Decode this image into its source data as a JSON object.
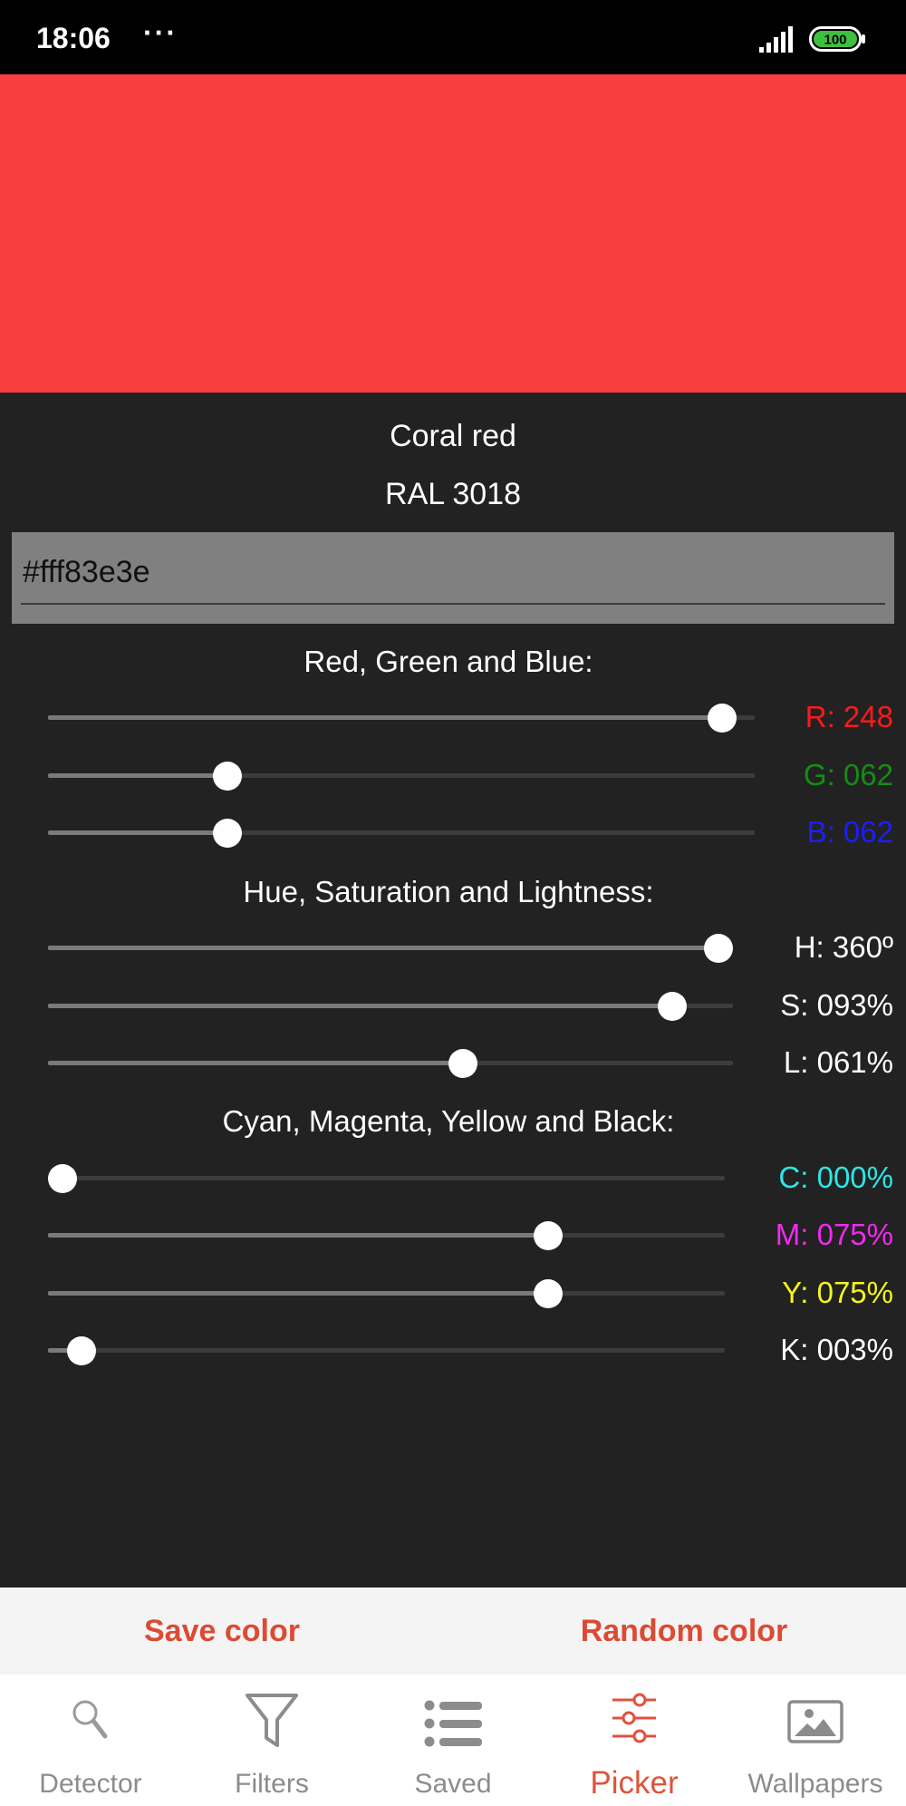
{
  "status": {
    "time": "18:06",
    "dots": "···",
    "battery": "100"
  },
  "colors": {
    "preview": "#f83e3e",
    "accent": "#db4b34",
    "red_label": "#ff1a1a",
    "green_label": "#168c16",
    "blue_label": "#1d1dff",
    "cyan_label": "#2ee6e6",
    "magenta_label": "#f02af0",
    "yellow_label": "#f5f51e",
    "white_label": "#ffffff"
  },
  "color": {
    "name": "Coral red",
    "ral": "RAL 3018",
    "hex": "#fff83e3e"
  },
  "rgb": {
    "title": "Red, Green and Blue:",
    "r": {
      "label": "R: 248",
      "level": 0.973
    },
    "g": {
      "label": "G: 062",
      "level": 0.243
    },
    "b": {
      "label": "B: 062",
      "level": 0.243
    }
  },
  "hsl": {
    "title": "Hue, Saturation and Lightness:",
    "h": {
      "label": "H: 360º",
      "level": 1.0
    },
    "s": {
      "label": "S: 093%",
      "level": 0.93
    },
    "l": {
      "label": "L: 061%",
      "level": 0.61
    }
  },
  "cmyk": {
    "title": "Cyan, Magenta, Yellow and Black:",
    "c": {
      "label": "C: 000%",
      "level": 0.0
    },
    "m": {
      "label": "M: 075%",
      "level": 0.75
    },
    "y": {
      "label": "Y: 075%",
      "level": 0.75
    },
    "k": {
      "label": "K: 003%",
      "level": 0.03
    }
  },
  "actions": {
    "save": "Save color",
    "random": "Random color"
  },
  "nav": [
    {
      "label": "Detector",
      "icon": "search-icon"
    },
    {
      "label": "Filters",
      "icon": "filter-icon"
    },
    {
      "label": "Saved",
      "icon": "list-icon"
    },
    {
      "label": "Picker",
      "icon": "sliders-icon",
      "active": true
    },
    {
      "label": "Wallpapers",
      "icon": "image-icon"
    }
  ]
}
